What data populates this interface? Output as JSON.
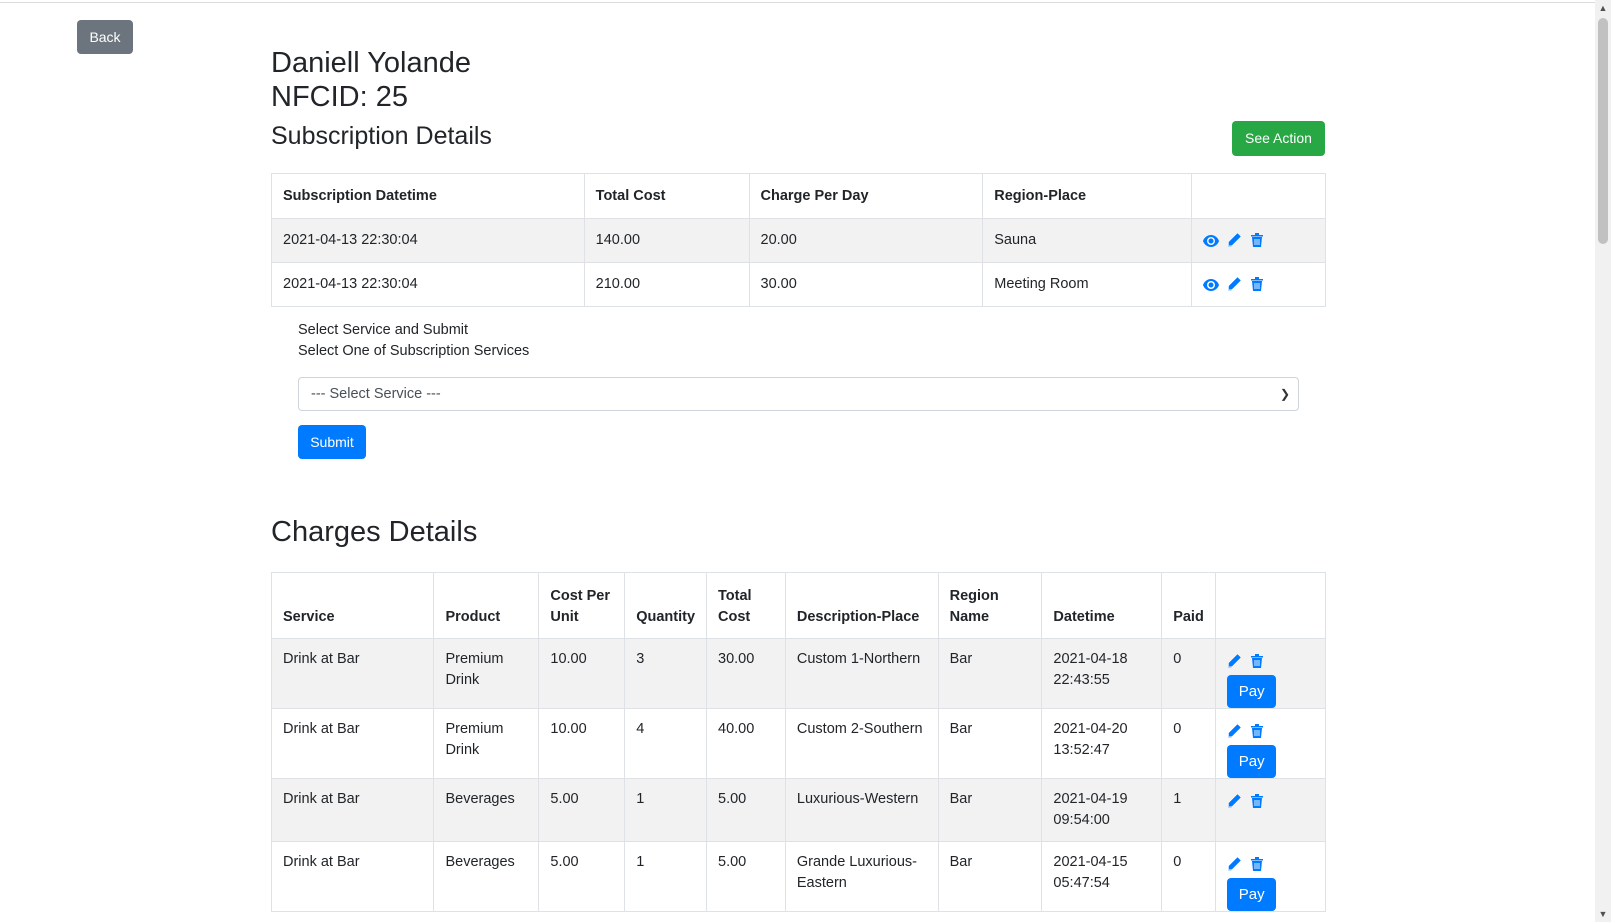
{
  "back_label": "Back",
  "customer": {
    "name": "Daniell Yolande",
    "nfcid": "NFCID: 25"
  },
  "subscription": {
    "title": "Subscription Details",
    "action_label": "See Action",
    "headers": [
      "Subscription Datetime",
      "Total Cost",
      "Charge Per Day",
      "Region-Place",
      ""
    ],
    "rows": [
      {
        "datetime": "2021-04-13 22:30:04",
        "total_cost": "140.00",
        "charge_per_day": "20.00",
        "region_place": "Sauna"
      },
      {
        "datetime": "2021-04-13 22:30:04",
        "total_cost": "210.00",
        "charge_per_day": "30.00",
        "region_place": "Meeting Room"
      }
    ]
  },
  "service_form": {
    "heading": "Select Service and Submit",
    "label": "Select One of Subscription Services",
    "select_value": "--- Select Service ---",
    "submit_label": "Submit"
  },
  "charges": {
    "title": "Charges Details",
    "headers": [
      "Service",
      "Product",
      "Cost Per Unit",
      "Quantity",
      "Total Cost",
      "Description-Place",
      "Region Name",
      "Datetime",
      "Paid",
      ""
    ],
    "pay_label": "Pay",
    "rows": [
      {
        "service": "Drink at Bar",
        "product": "Premium Drink",
        "cost_per_unit": "10.00",
        "quantity": "3",
        "total_cost": "30.00",
        "description_place": "Custom 1-Northern",
        "region_name": "Bar",
        "datetime": "2021-04-18 22:43:55",
        "paid": "0"
      },
      {
        "service": "Drink at Bar",
        "product": "Premium Drink",
        "cost_per_unit": "10.00",
        "quantity": "4",
        "total_cost": "40.00",
        "description_place": "Custom 2-Southern",
        "region_name": "Bar",
        "datetime": "2021-04-20 13:52:47",
        "paid": "0"
      },
      {
        "service": "Drink at Bar",
        "product": "Beverages",
        "cost_per_unit": "5.00",
        "quantity": "1",
        "total_cost": "5.00",
        "description_place": "Luxurious-Western",
        "region_name": "Bar",
        "datetime": "2021-04-19 09:54:00",
        "paid": "1"
      },
      {
        "service": "Drink at Bar",
        "product": "Beverages",
        "cost_per_unit": "5.00",
        "quantity": "1",
        "total_cost": "5.00",
        "description_place": "Grande Luxurious-Eastern",
        "region_name": "Bar",
        "datetime": "2021-04-15 05:47:54",
        "paid": "0"
      }
    ]
  },
  "icons": {
    "view": "eye-icon",
    "edit": "pencil-icon",
    "delete": "trash-icon"
  },
  "colors": {
    "primary": "#007bff",
    "success": "#28a745",
    "secondary": "#6c757d"
  }
}
